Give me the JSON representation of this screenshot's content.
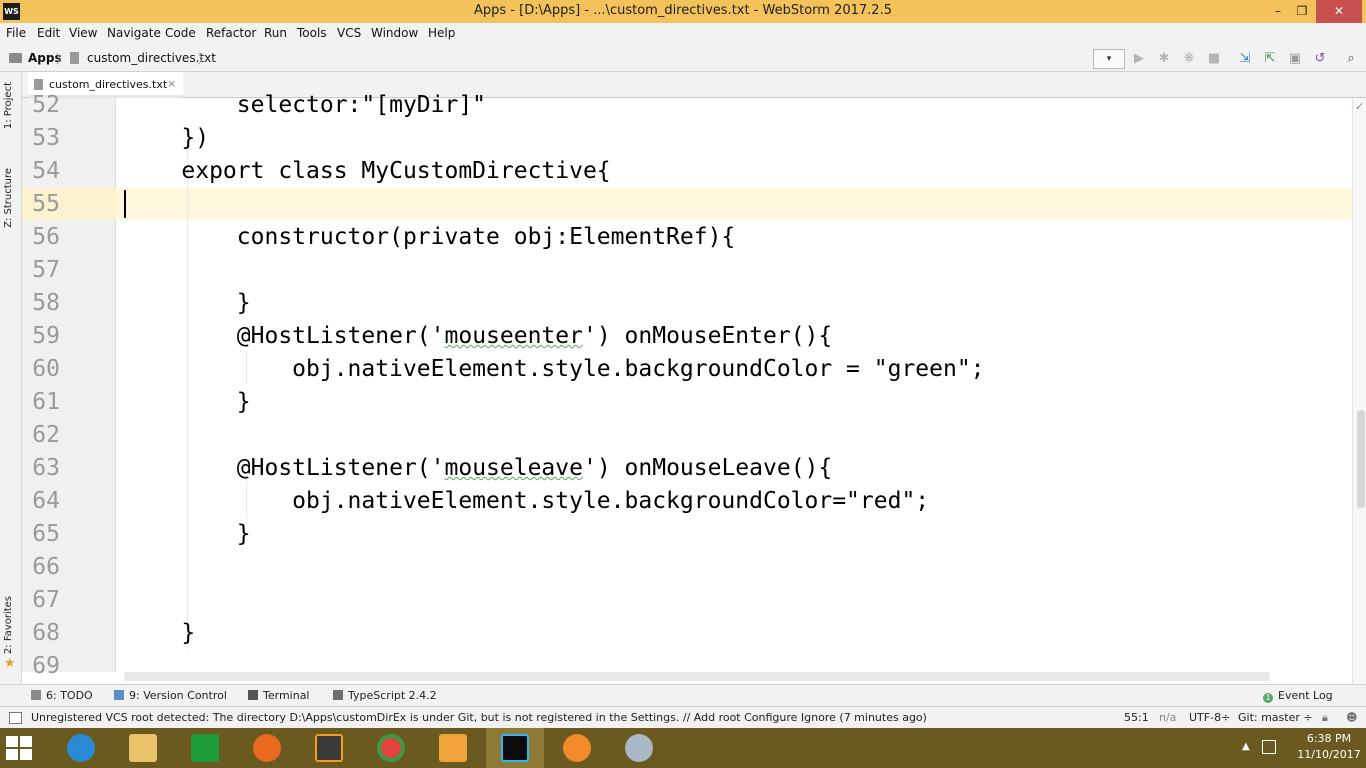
{
  "window": {
    "title": "Apps - [D:\\Apps] - ...\\custom_directives.txt - WebStorm 2017.2.5",
    "app_icon_text": "WS",
    "minimize_label": "–",
    "maximize_label": "❐",
    "close_label": "✕"
  },
  "menu": [
    "File",
    "Edit",
    "View",
    "Navigate",
    "Code",
    "Refactor",
    "Run",
    "Tools",
    "VCS",
    "Window",
    "Help"
  ],
  "breadcrumb": {
    "project": "Apps",
    "file": "custom_directives.txt",
    "separator": "〉"
  },
  "toolbar": {
    "combo_label": "▾",
    "icons": [
      "run-icon",
      "debug-icon",
      "coverage-icon",
      "stop-icon",
      "vcs-update-icon",
      "vcs-commit-icon",
      "vcs-compare-icon",
      "revert-icon",
      "search-icon"
    ]
  },
  "left_strip": {
    "project": "1: Project",
    "structure": "Z: Structure",
    "favorites": "2: Favorites"
  },
  "editor": {
    "tab_label": "custom_directives.txt",
    "tab_close": "×",
    "line_numbers": [
      "52",
      "53",
      "54",
      "55",
      "56",
      "57",
      "58",
      "59",
      "60",
      "61",
      "62",
      "63",
      "64",
      "65",
      "66",
      "67",
      "68",
      "69"
    ],
    "lines": [
      "        selector:\"[myDir]\"",
      "    })",
      "    export class MyCustomDirective{",
      "",
      "        constructor(private obj:ElementRef){",
      "",
      "        }",
      "        @HostListener('mouseenter') onMouseEnter(){",
      "            obj.nativeElement.style.backgroundColor = \"green\";",
      "        }",
      "",
      "        @HostListener('mouseleave') onMouseLeave(){",
      "            obj.nativeElement.style.backgroundColor=\"red\";",
      "        }",
      "",
      "",
      "    }",
      ""
    ],
    "current_line": "55"
  },
  "bottom_tools": {
    "todo": "6: TODO",
    "version_control": "9: Version Control",
    "terminal": "Terminal",
    "typescript": "TypeScript 2.4.2",
    "event_log": "Event Log",
    "event_count": "1"
  },
  "status": {
    "message": "Unregistered VCS root detected: The directory D:\\Apps\\customDirEx is under Git, but is not registered in the Settings. // Add root  Configure  Ignore (7 minutes ago)",
    "position": "55:1",
    "na": "n/a",
    "encoding": "UTF-8÷",
    "git": "Git: master ÷"
  },
  "taskbar": {
    "apps": [
      "internet-explorer-icon",
      "file-explorer-icon",
      "store-icon",
      "firefox-icon",
      "sublime-icon",
      "chrome-icon",
      "media-player-icon",
      "webstorm-icon",
      "flower-app-icon",
      "paint-icon"
    ],
    "active_app": "webstorm-icon",
    "time": "6:38 PM",
    "date": "11/10/2017"
  },
  "colors": {
    "titlebar": "#f3c25b",
    "taskbar": "#6b5a1f",
    "current_line": "#fff8dc",
    "close_button": "#c7504e"
  }
}
